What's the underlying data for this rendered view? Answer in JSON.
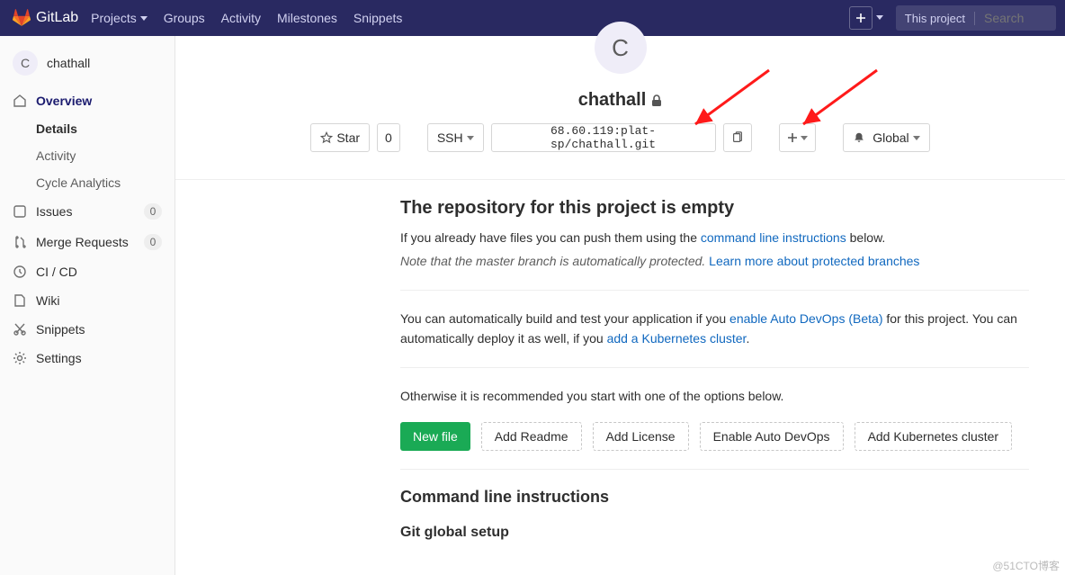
{
  "nav": {
    "brand": "GitLab",
    "projects": "Projects",
    "groups": "Groups",
    "activity": "Activity",
    "milestones": "Milestones",
    "snippets": "Snippets",
    "search_scope": "This project",
    "search_placeholder": "Search"
  },
  "sidebar": {
    "project_initial": "C",
    "project_name": "chathall",
    "overview": "Overview",
    "details": "Details",
    "activity": "Activity",
    "cycle": "Cycle Analytics",
    "issues": "Issues",
    "issues_count": "0",
    "mrs": "Merge Requests",
    "mrs_count": "0",
    "cicd": "CI / CD",
    "wiki": "Wiki",
    "snippets": "Snippets",
    "settings": "Settings"
  },
  "project": {
    "avatar_letter": "C",
    "title": "chathall",
    "star": "Star",
    "star_count": "0",
    "protocol": "SSH",
    "clone_url": "68.60.119:plat-sp/chathall.git",
    "notify": "Global"
  },
  "empty": {
    "heading": "The repository for this project is empty",
    "push_prefix": "If you already have files you can push them using the ",
    "cli_link": "command line instructions",
    "push_suffix": " below.",
    "note_prefix": "Note that the master branch is automatically protected. ",
    "note_link": "Learn more about protected branches",
    "auto_prefix": "You can automatically build and test your application if you ",
    "auto_link": "enable Auto DevOps (Beta)",
    "auto_mid": " for this project. You can automatically deploy it as well, if you ",
    "kube_link": "add a Kubernetes cluster",
    "auto_suffix": ".",
    "otherwise": "Otherwise it is recommended you start with one of the options below.",
    "new_file": "New file",
    "add_readme": "Add Readme",
    "add_license": "Add License",
    "enable_autodevops": "Enable Auto DevOps",
    "add_kubernetes": "Add Kubernetes cluster",
    "cli_heading": "Command line instructions",
    "git_setup": "Git global setup"
  },
  "watermark": "@51CTO博客"
}
